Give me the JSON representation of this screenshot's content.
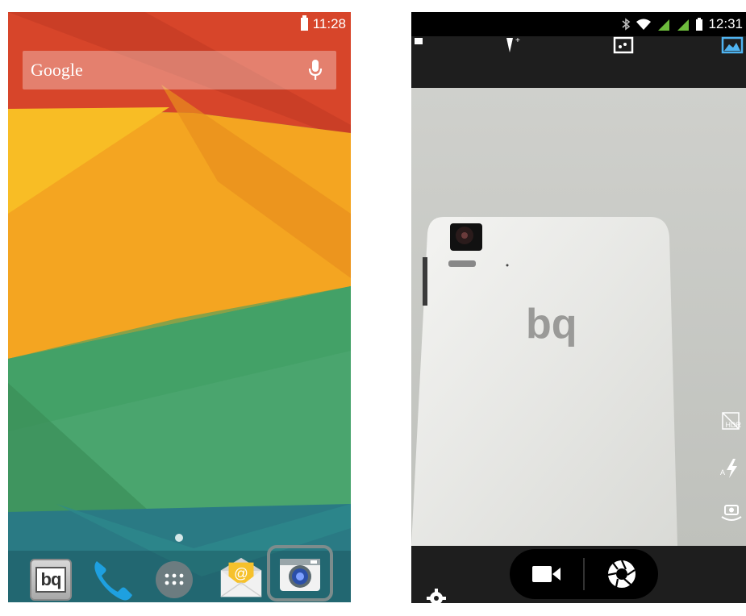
{
  "home": {
    "status": {
      "time": "11:28"
    },
    "search": {
      "logo_text": "Google"
    },
    "dock": {
      "bq_label": "bq"
    },
    "colors": {
      "red": "#d7452a",
      "orange": "#f4a521",
      "green": "#4aa56e",
      "teal": "#2a7a84"
    }
  },
  "camera": {
    "status": {
      "time": "12:31"
    },
    "hdr_label": "HDR",
    "flash_auto_label": "A",
    "device_logo": "bq"
  }
}
